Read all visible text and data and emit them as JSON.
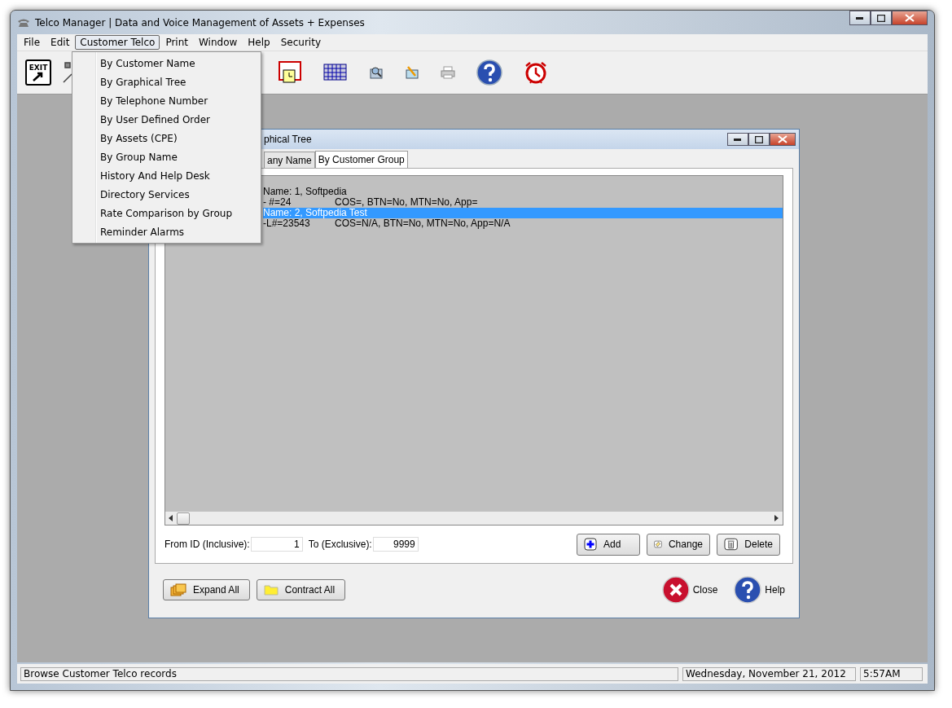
{
  "window": {
    "title": "Telco Manager | Data and Voice Management of Assets + Expenses"
  },
  "menu_bar": [
    {
      "label": "File",
      "selected": false
    },
    {
      "label": "Edit",
      "selected": false
    },
    {
      "label": "Customer Telco",
      "selected": true
    },
    {
      "label": "Print",
      "selected": false
    },
    {
      "label": "Window",
      "selected": false
    },
    {
      "label": "Help",
      "selected": false
    },
    {
      "label": "Security",
      "selected": false
    }
  ],
  "toolbar": {
    "exit_label": "EXIT"
  },
  "dropdown_menu": [
    "By Customer Name",
    "By Graphical Tree",
    "By Telephone Number",
    "By User Defined Order",
    "By Assets (CPE)",
    "By Group Name",
    "History And Help Desk",
    "Directory Services",
    "Rate Comparison by Group",
    "Reminder Alarms"
  ],
  "child_window": {
    "title": "phical Tree",
    "tabs": [
      {
        "label": "any Name",
        "selected": false
      },
      {
        "label": "By Customer Group",
        "selected": true
      }
    ],
    "tree": [
      {
        "label": "Name: 1, Softpedia",
        "selected": false,
        "children": [
          {
            "label": "- #=24",
            "details": "COS=, BTN=No, MTN=No, App="
          }
        ]
      },
      {
        "label": "Name: 2, Softpedia Test",
        "selected": true,
        "children": [
          {
            "label": "-L#=23543",
            "details": "COS=N/A, BTN=No, MTN=No, App=N/A"
          }
        ]
      }
    ],
    "from_label": "From ID (Inclusive):",
    "from_value": "1",
    "to_label": "To (Exclusive):",
    "to_value": "9999",
    "actions": [
      {
        "kind": "add",
        "label": "Add"
      },
      {
        "kind": "change",
        "label": "Change"
      },
      {
        "kind": "delete",
        "label": "Delete"
      }
    ],
    "tree_buttons": [
      {
        "kind": "expand",
        "label": "Expand All"
      },
      {
        "kind": "contract",
        "label": "Contract All"
      }
    ],
    "dialog_buttons": [
      {
        "kind": "close",
        "label": "Close"
      },
      {
        "kind": "help",
        "label": "Help"
      }
    ]
  },
  "status_bar": {
    "message": "Browse Customer Telco records",
    "date": "Wednesday, November 21, 2012",
    "time": "5:57AM"
  }
}
